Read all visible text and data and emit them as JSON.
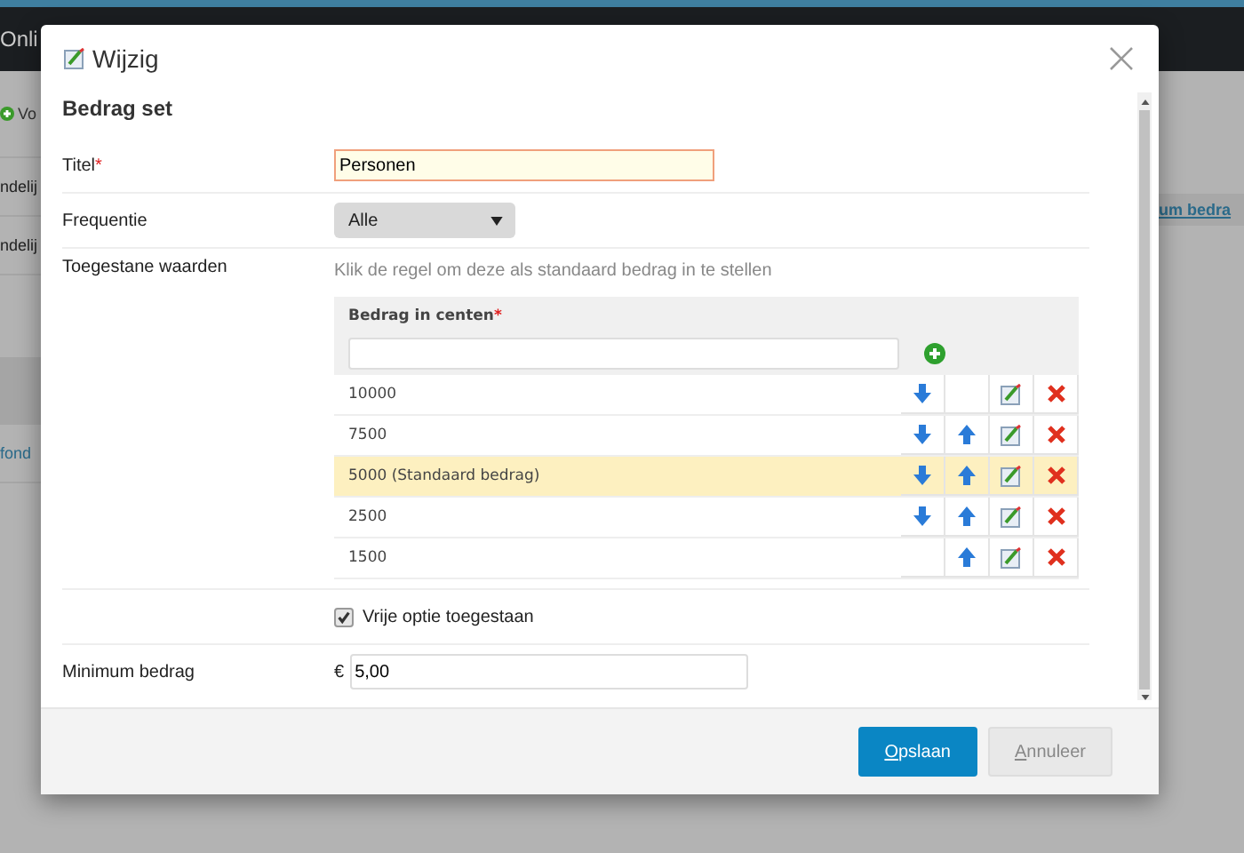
{
  "background": {
    "app_title": "Onli",
    "add_button": "Vo",
    "left_rows": [
      "ndelij",
      "ndelij"
    ],
    "left_link": "fond",
    "right_link": "um bedra"
  },
  "dialog": {
    "title": "Wijzig",
    "section": "Bedrag set",
    "title_field": {
      "label": "Titel",
      "required_mark": "*",
      "value": "Personen",
      "focused": true
    },
    "frequency": {
      "label": "Frequentie",
      "value": "Alle"
    },
    "allowed_values": {
      "label": "Toegestane waarden",
      "hint": "Klik de regel om deze als standaard bedrag in te stellen",
      "column": "Bedrag in centen",
      "required_mark": "*",
      "rows": [
        {
          "amount": "10000",
          "selected": false,
          "can_move_down": true,
          "can_move_up": false
        },
        {
          "amount": "7500",
          "selected": false,
          "can_move_down": true,
          "can_move_up": true
        },
        {
          "amount": "5000 (Standaard bedrag)",
          "selected": true,
          "can_move_down": true,
          "can_move_up": true
        },
        {
          "amount": "2500",
          "selected": false,
          "can_move_down": true,
          "can_move_up": true
        },
        {
          "amount": "1500",
          "selected": false,
          "can_move_down": false,
          "can_move_up": true
        }
      ]
    },
    "free_option": {
      "label": "Vrije optie toegestaan",
      "checked": true
    },
    "minimum": {
      "label": "Minimum bedrag",
      "currency": "€",
      "value": "5,00"
    },
    "buttons": [
      {
        "label": "Opslaan",
        "kind": "primary"
      },
      {
        "label": "Annuleer",
        "kind": "secondary"
      }
    ]
  }
}
